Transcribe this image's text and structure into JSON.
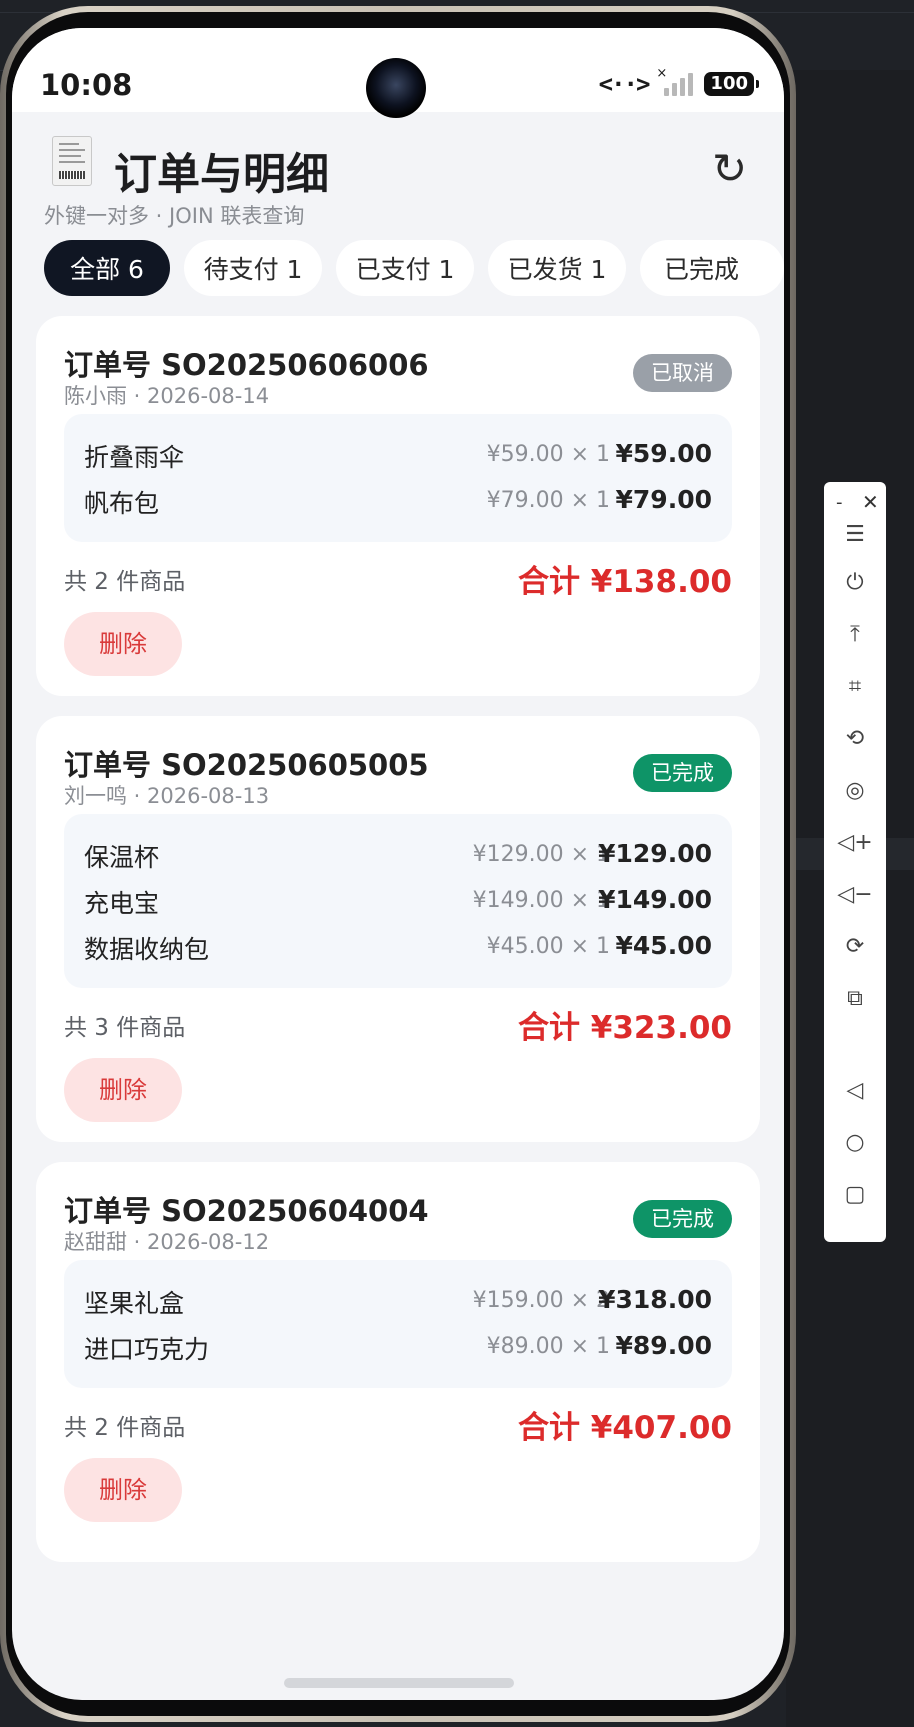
{
  "status_bar": {
    "time": "10:08",
    "battery": "100"
  },
  "header": {
    "title": "订单与明细",
    "subtitle": "外键一对多 · JOIN 联表查询",
    "refresh_icon": "refresh-icon",
    "receipt_icon": "receipt-icon"
  },
  "filters": [
    {
      "label": "全部 6",
      "active": true
    },
    {
      "label": "待支付 1",
      "active": false
    },
    {
      "label": "已支付 1",
      "active": false
    },
    {
      "label": "已发货 1",
      "active": false
    },
    {
      "label": "已完成",
      "active": false
    }
  ],
  "orders": [
    {
      "order_no": "订单号 SO20250606006",
      "meta": "陈小雨 · 2026-08-14",
      "status": "已取消",
      "status_color": "#9aa0a8",
      "items": [
        {
          "name": "折叠雨伞",
          "unit": "¥59.00 × 1",
          "subtotal": "¥59.00"
        },
        {
          "name": "帆布包",
          "unit": "¥79.00 × 1",
          "subtotal": "¥79.00"
        }
      ],
      "count": "共 2 件商品",
      "total": "合计 ¥138.00",
      "delete_label": "删除"
    },
    {
      "order_no": "订单号 SO20250605005",
      "meta": "刘一鸣 · 2026-08-13",
      "status": "已完成",
      "status_color": "#0e9467",
      "items": [
        {
          "name": "保温杯",
          "unit": "¥129.00 × 1",
          "subtotal": "¥129.00"
        },
        {
          "name": "充电宝",
          "unit": "¥149.00 × 1",
          "subtotal": "¥149.00"
        },
        {
          "name": "数据收纳包",
          "unit": "¥45.00 × 1",
          "subtotal": "¥45.00"
        }
      ],
      "count": "共 3 件商品",
      "total": "合计 ¥323.00",
      "delete_label": "删除"
    },
    {
      "order_no": "订单号 SO20250604004",
      "meta": "赵甜甜 · 2026-08-12",
      "status": "已完成",
      "status_color": "#0e9467",
      "items": [
        {
          "name": "坚果礼盒",
          "unit": "¥159.00 × 2",
          "subtotal": "¥318.00"
        },
        {
          "name": "进口巧克力",
          "unit": "¥89.00 × 1",
          "subtotal": "¥89.00"
        }
      ],
      "count": "共 2 件商品",
      "total": "合计 ¥407.00",
      "delete_label": "删除"
    }
  ],
  "toolbar": {
    "min": "-",
    "close": "✕",
    "icons": [
      {
        "name": "menu-icon",
        "glyph": "☰"
      },
      {
        "name": "power-icon",
        "glyph": "⏻"
      },
      {
        "name": "pin-top-icon",
        "glyph": "⤒"
      },
      {
        "name": "crop-icon",
        "glyph": "⌗"
      },
      {
        "name": "rotate-icon",
        "glyph": "⟲"
      },
      {
        "name": "screenshot-icon",
        "glyph": "◎"
      },
      {
        "name": "volume-up-icon",
        "glyph": "🔊"
      },
      {
        "name": "volume-down-icon",
        "glyph": "🔉"
      },
      {
        "name": "shake-icon",
        "glyph": "⟳"
      },
      {
        "name": "multi-screen-icon",
        "glyph": "⧉"
      },
      {
        "name": "back-icon",
        "glyph": "◁"
      },
      {
        "name": "home-icon",
        "glyph": "○"
      },
      {
        "name": "recents-icon",
        "glyph": "▢"
      }
    ]
  }
}
